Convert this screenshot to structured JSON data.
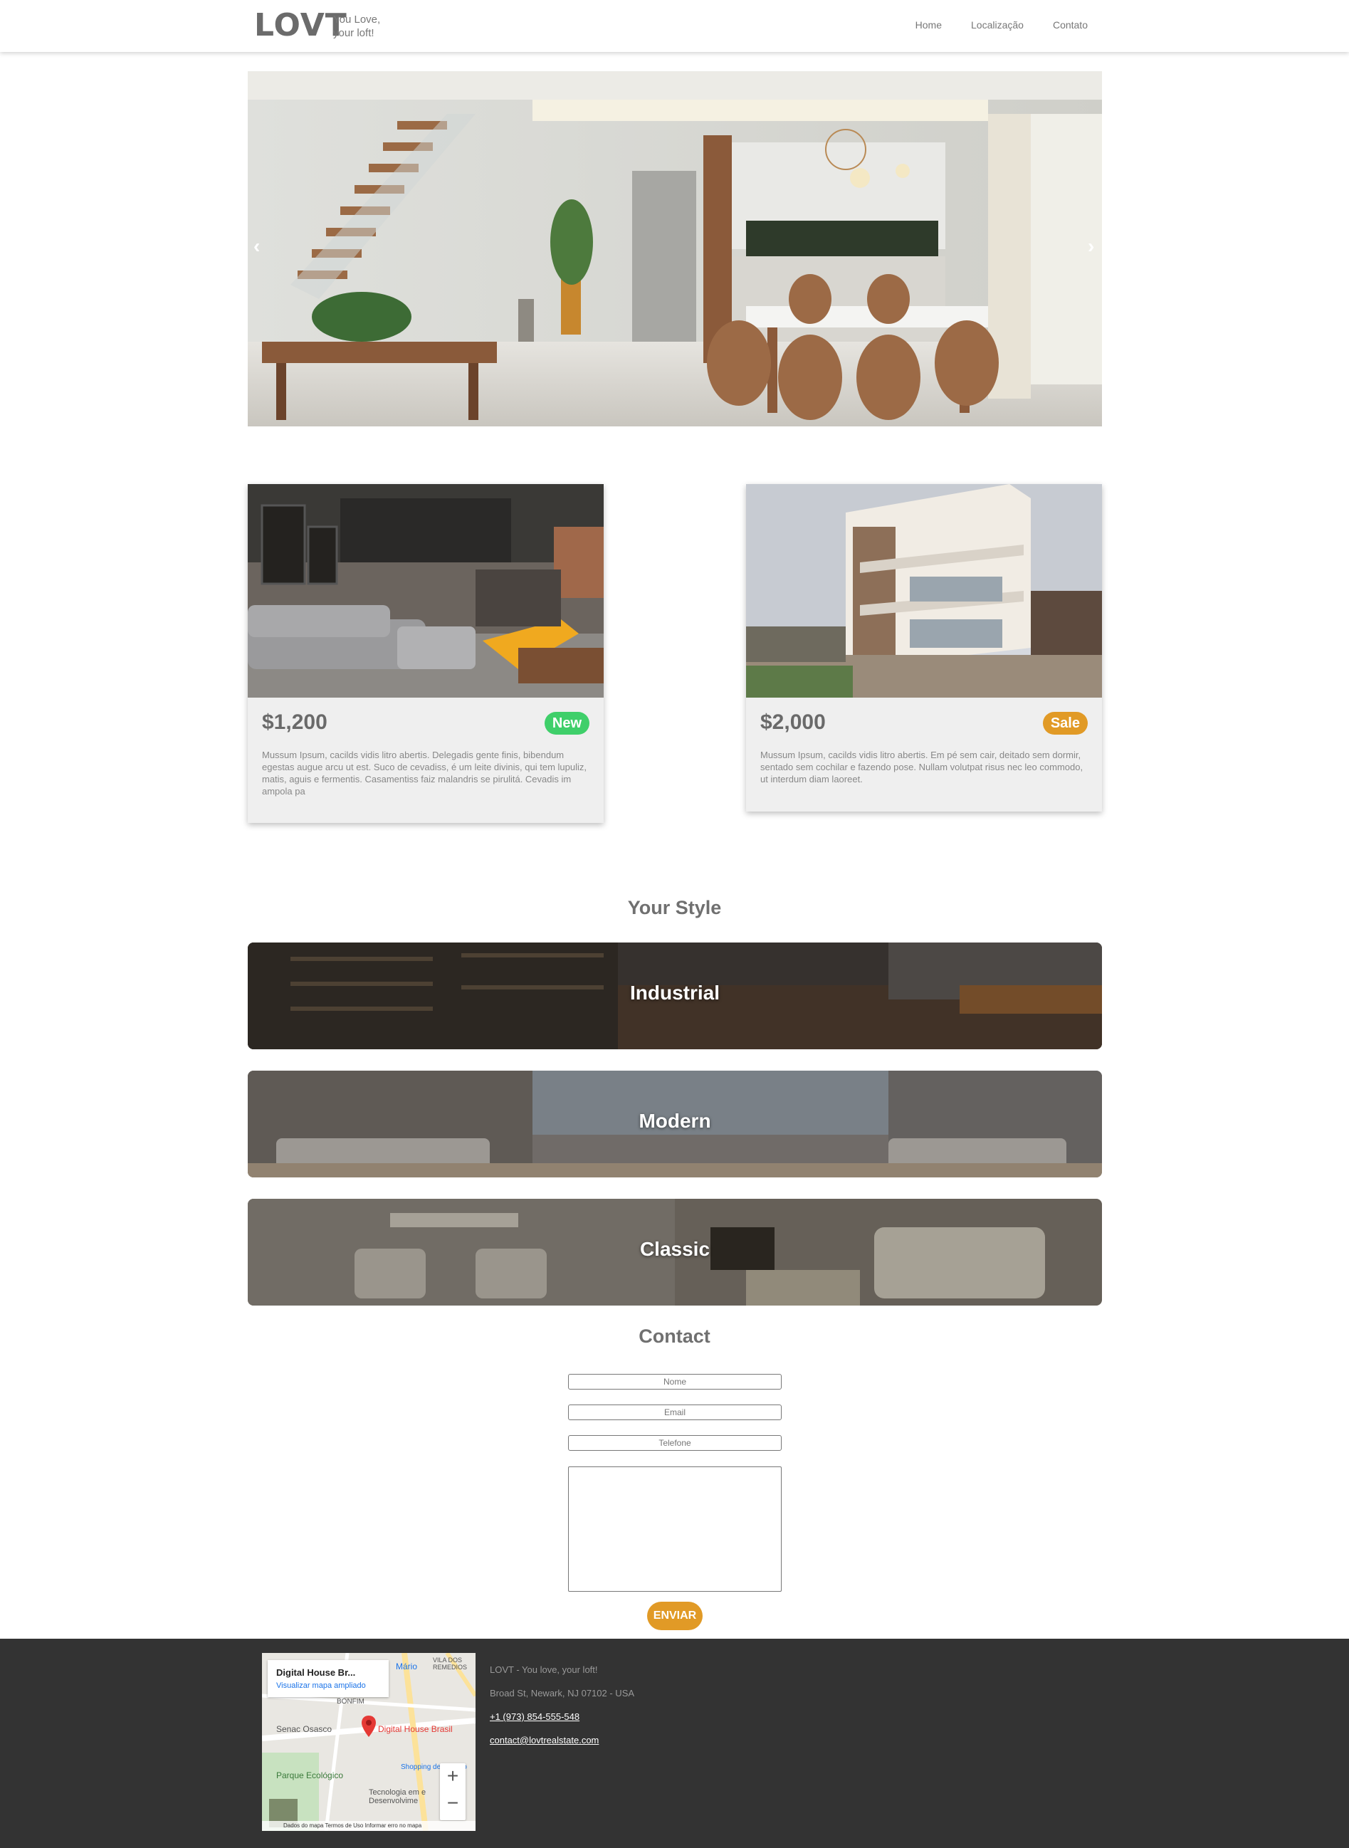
{
  "nav": {
    "logo": "LOVT",
    "tagline_line1": "You Love,",
    "tagline_line2": "your loft!",
    "links": [
      "Home",
      "Localização",
      "Contato"
    ]
  },
  "hero": {
    "prev": "‹",
    "next": "›"
  },
  "cards": [
    {
      "price": "$1,200",
      "badge": "New",
      "description": "Mussum Ipsum, cacilds vidis litro abertis. Delegadis gente finis, bibendum egestas augue arcu ut est. Suco de cevadiss, é um leite divinis, qui tem lupuliz, matis, aguis e fermentis. Casamentiss faiz malandris se pirulitá. Cevadis im ampola pa"
    },
    {
      "price": "$2,000",
      "badge": "Sale",
      "description": "Mussum Ipsum, cacilds vidis litro abertis. Em pé sem cair, deitado sem dormir, sentado sem cochilar e fazendo pose. Nullam volutpat risus nec leo commodo, ut interdum diam laoreet."
    }
  ],
  "styles": {
    "title": "Your Style",
    "items": [
      "Industrial",
      "Modern",
      "Classic"
    ]
  },
  "contact": {
    "title": "Contact",
    "name_placeholder": "Nome",
    "email_placeholder": "Email",
    "phone_placeholder": "Telefone",
    "send": "ENVIAR"
  },
  "map": {
    "place_title": "Digital House Br...",
    "enlarge_link": "Visualizar mapa ampliado",
    "marker_label": "Digital House Brasil",
    "labels": [
      "Senac Osasco",
      "BONFIM",
      "Parque Ecológico",
      "Shopping de Osasco",
      "Tecnologia em e Desenvolvime",
      "VILA DOS REMEDIOS",
      "Mário"
    ],
    "zoom_in": "+",
    "zoom_out": "−",
    "footer": "Dados do mapa   Termos de Uso   Informar erro no mapa"
  },
  "footer": {
    "brand": "LOVT - You love, your loft!",
    "address": "Broad St, Newark, NJ 07102 - USA",
    "phone": "+1 (973) 854-555-548",
    "email": "contact@lovtrealstate.com"
  },
  "colors": {
    "accent": "#e19a26",
    "new_badge": "#3fcf6a",
    "footer_bg": "#333333"
  }
}
